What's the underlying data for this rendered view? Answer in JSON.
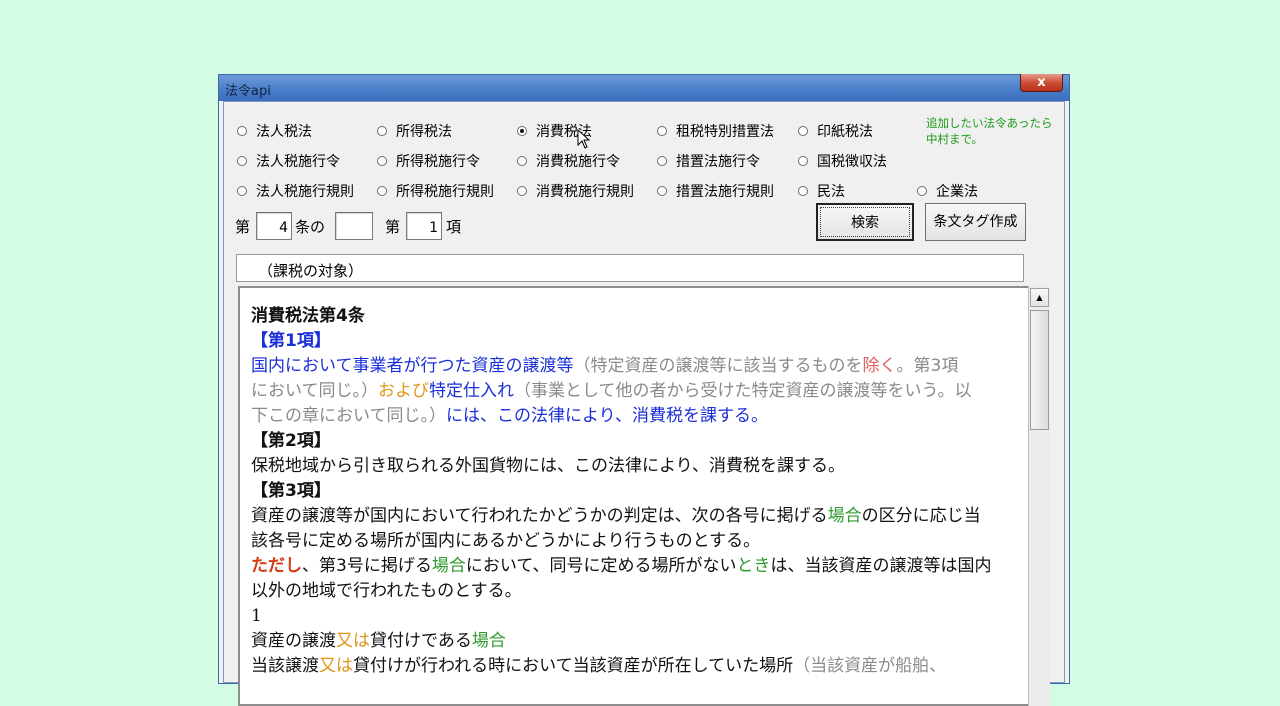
{
  "window": {
    "title": "法令api",
    "close_label": "x"
  },
  "radios": [
    {
      "label": "法人税法",
      "checked": false
    },
    {
      "label": "所得税法",
      "checked": false
    },
    {
      "label": "消費税法",
      "checked": true
    },
    {
      "label": "租税特別措置法",
      "checked": false
    },
    {
      "label": "印紙税法",
      "checked": false
    },
    {
      "label": "法人税施行令",
      "checked": false
    },
    {
      "label": "所得税施行令",
      "checked": false
    },
    {
      "label": "消費税施行令",
      "checked": false
    },
    {
      "label": "措置法施行令",
      "checked": false
    },
    {
      "label": "国税徴収法",
      "checked": false
    },
    {
      "label": "法人税施行規則",
      "checked": false
    },
    {
      "label": "所得税施行規則",
      "checked": false
    },
    {
      "label": "消費税施行規則",
      "checked": false
    },
    {
      "label": "措置法施行規則",
      "checked": false
    },
    {
      "label": "民法",
      "checked": false
    },
    {
      "label": "企業法",
      "checked": false
    }
  ],
  "note": "追加したい法令あったら\n中村まで。",
  "form": {
    "dai": "第",
    "article": "4",
    "jou_no": "条の",
    "sub_article": "",
    "dai2": "第",
    "paragraph": "1",
    "kou": "項",
    "search_label": "検索",
    "tag_label": "条文タグ作成"
  },
  "caption": "（課税の対象）",
  "content": {
    "title": "消費税法第4条",
    "p1_head": "【第1項】",
    "p1_a": "国内において事業者が行つた資産の譲渡等",
    "p1_b": "（特定資産の譲渡等に該当するものを",
    "p1_c": "除く",
    "p1_d": "。第3項",
    "p1_e": "において同じ。）",
    "p1_f": "および",
    "p1_g": "特定仕入れ",
    "p1_h": "（事業として他の者から受けた特定資産の譲渡等をいう。以",
    "p1_i": "下この章において同じ。）",
    "p1_j": "には、この法律により、消費税を課する。",
    "p2_head": "【第2項】",
    "p2_text": "保税地域から引き取られる外国貨物には、この法律により、消費税を課する。",
    "p3_head": "【第3項】",
    "p3_a": "資産の譲渡等が国内において行われたかどうかの判定は、次の各号に掲げる",
    "p3_b": "場合",
    "p3_c": "の区分に応じ当",
    "p3_d": "該各号に定める場所が国内にあるかどうかにより行うものとする。",
    "p3_e": "ただし",
    "p3_f": "、第3号に掲げる",
    "p3_g": "場合",
    "p3_h": "において、同号に定める場所がない",
    "p3_i": "とき",
    "p3_j": "は、当該資産の譲渡等は国内",
    "p3_k": "以外の地域で行われたものとする。",
    "item_no": "1",
    "i1_a": "資産の譲渡",
    "i1_b": "又は",
    "i1_c": "貸付けである",
    "i1_d": "場合",
    "i2_a": "当該譲渡",
    "i2_b": "又は",
    "i2_c": "貸付けが行われる時において当該資産が所在していた場所",
    "i2_d": "（当該資産が船舶、"
  }
}
